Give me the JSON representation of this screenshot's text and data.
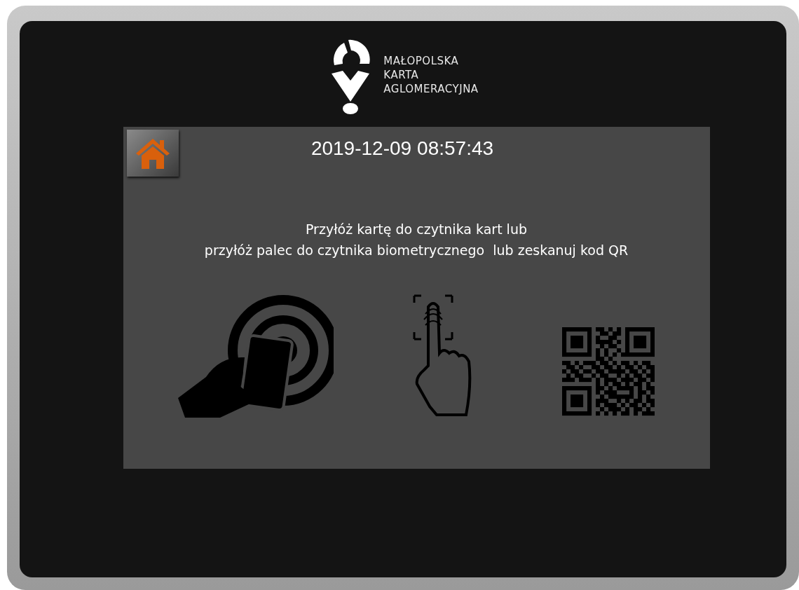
{
  "logo": {
    "lines": [
      "MAŁOPOLSKA",
      "KARTA",
      "AGLOMERACYJNA"
    ]
  },
  "panel": {
    "date": "2019-12-09",
    "time": "08:57:43",
    "instructions": [
      "Przyłóż kartę do czytnika kart lub",
      "przyłóż palec do czytnika biometrycznego  lub zeskanuj kod QR"
    ],
    "methods": [
      {
        "kind": "card"
      },
      {
        "kind": "fingerprint"
      },
      {
        "kind": "qr"
      }
    ]
  }
}
